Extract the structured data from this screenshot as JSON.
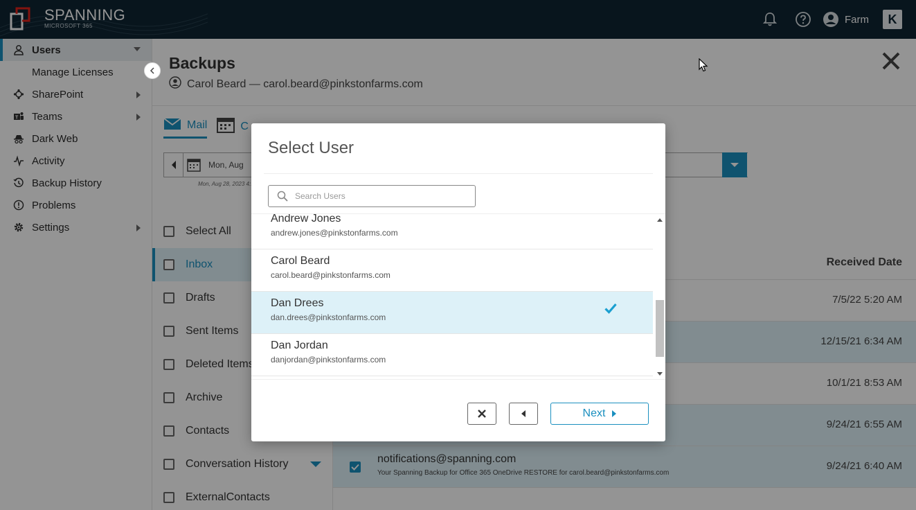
{
  "app": {
    "brand": "SPANNING",
    "brand_sub": "MICROSOFT 365",
    "user_label": "Farm",
    "tenant_badge": "K",
    "colors": {
      "topbar": "#0f2533",
      "accent": "#1a8fbf",
      "selected_bg": "#ddf1f8"
    }
  },
  "sidebar": {
    "items": [
      {
        "label": "Users",
        "icon": "user-icon",
        "active": true
      },
      {
        "label": "Manage Licenses",
        "icon": ""
      },
      {
        "label": "SharePoint",
        "icon": "sharepoint-icon"
      },
      {
        "label": "Teams",
        "icon": "teams-icon"
      },
      {
        "label": "Dark Web",
        "icon": "spy-icon"
      },
      {
        "label": "Activity",
        "icon": "activity-icon"
      },
      {
        "label": "Backup History",
        "icon": "history-icon"
      },
      {
        "label": "Problems",
        "icon": "alert-icon"
      },
      {
        "label": "Settings",
        "icon": "gear-icon"
      }
    ]
  },
  "main": {
    "title": "Backups",
    "subtitle": "Carol Beard — carol.beard@pinkstonfarms.com",
    "tabs": [
      {
        "label": "Mail",
        "active": true
      },
      {
        "label": "C"
      }
    ],
    "date_text": "Mon, Aug",
    "date_caption": "Mon, Aug 28, 2023 4:1",
    "folders": [
      {
        "label": "Select All"
      },
      {
        "label": "Inbox",
        "selected": true
      },
      {
        "label": "Drafts"
      },
      {
        "label": "Sent Items"
      },
      {
        "label": "Deleted Items"
      },
      {
        "label": "Archive"
      },
      {
        "label": "Contacts"
      },
      {
        "label": "Conversation History"
      },
      {
        "label": "ExternalContacts"
      }
    ],
    "received_header": "Received Date",
    "messages": [
      {
        "date": "7/5/22 5:20 AM"
      },
      {
        "date": "12/15/21 6:34 AM"
      },
      {
        "date": "10/1/21 8:53 AM"
      },
      {
        "date": "9/24/21 6:55 AM"
      },
      {
        "from": "notifications@spanning.com",
        "snippet": "Your Spanning Backup for Office 365 OneDrive RESTORE for carol.beard@pinkstonfarms.com",
        "date": "9/24/21 6:40 AM"
      }
    ]
  },
  "modal": {
    "title": "Select User",
    "search_placeholder": "Search Users",
    "users": [
      {
        "name": "Andrew Jones",
        "email": "andrew.jones@pinkstonfarms.com"
      },
      {
        "name": "Carol Beard",
        "email": "carol.beard@pinkstonfarms.com"
      },
      {
        "name": "Dan Drees",
        "email": "dan.drees@pinkstonfarms.com",
        "selected": true
      },
      {
        "name": "Dan Jordan",
        "email": "danjordan@pinkstonfarms.com"
      }
    ],
    "next_label": "Next"
  }
}
